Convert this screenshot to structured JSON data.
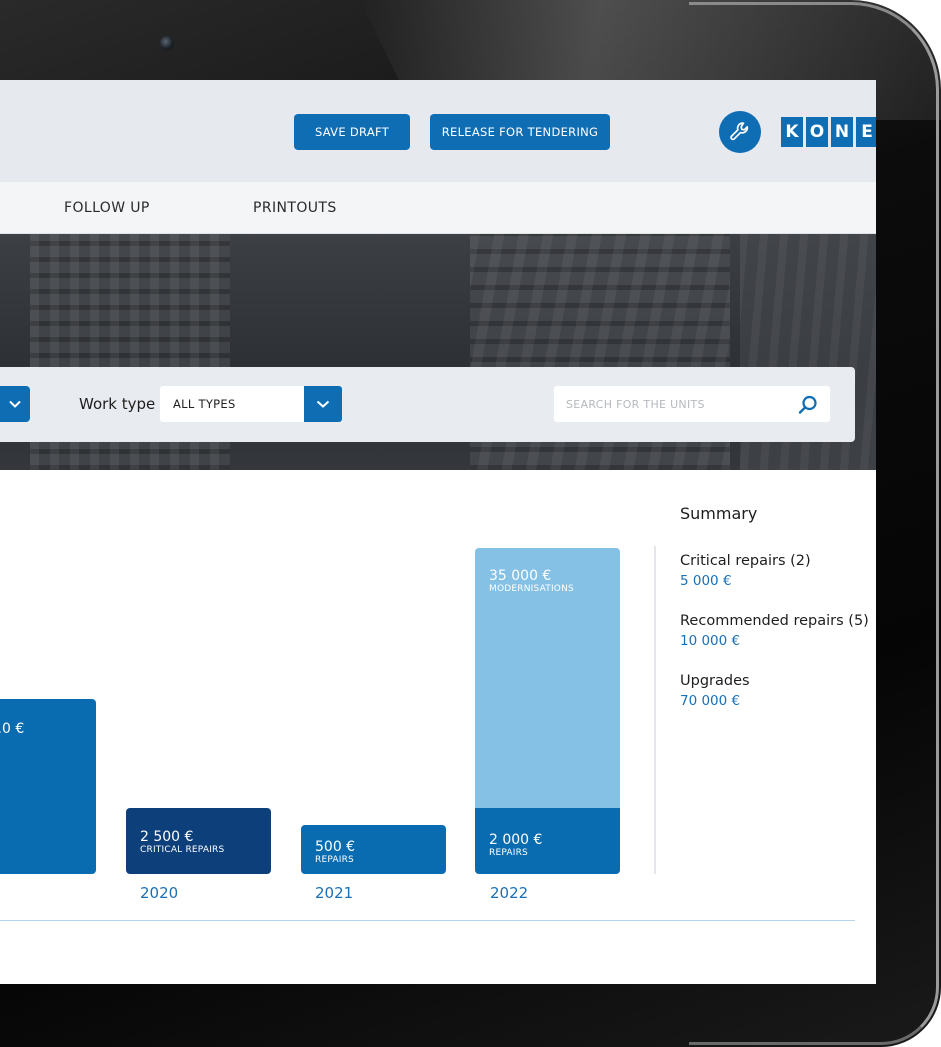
{
  "header": {
    "save_draft_label": "SAVE DRAFT",
    "release_label": "RELEASE FOR TENDERING",
    "logo_letters": [
      "K",
      "O",
      "N",
      "E"
    ]
  },
  "nav": {
    "items": [
      {
        "label": "FOLLOW UP"
      },
      {
        "label": "PRINTOUTS"
      }
    ]
  },
  "filters": {
    "work_type_label": "Work type",
    "work_type_value": "ALL TYPES",
    "search_placeholder": "SEARCH FOR THE UNITS"
  },
  "chart_data": {
    "type": "bar",
    "stacked": true,
    "categories": [
      "",
      "2020",
      "2021",
      "2022"
    ],
    "bars": [
      {
        "year": "",
        "segments": [
          {
            "amount": "…0 €",
            "label": "",
            "value": 17500,
            "color": "#0a6cb0"
          }
        ]
      },
      {
        "year": "2020",
        "segments": [
          {
            "amount": "2 500 €",
            "label": "CRITICAL REPAIRS",
            "value": 2500,
            "color": "#0d3f7a"
          }
        ]
      },
      {
        "year": "2021",
        "segments": [
          {
            "amount": "500 €",
            "label": "REPAIRS",
            "value": 500,
            "color": "#0a6cb0"
          }
        ]
      },
      {
        "year": "2022",
        "segments": [
          {
            "amount": "2 000 €",
            "label": "REPAIRS",
            "value": 2000,
            "color": "#0a6cb0"
          },
          {
            "amount": "35 000 €",
            "label": "MODERNISATIONS",
            "value": 35000,
            "color": "#85c1e5"
          }
        ]
      }
    ]
  },
  "summary": {
    "title": "Summary",
    "items": [
      {
        "label": "Critical repairs (2)",
        "value": "5 000 €"
      },
      {
        "label": "Recommended repairs (5)",
        "value": "10 000 €"
      },
      {
        "label": "Upgrades",
        "value": "70 000 €"
      }
    ]
  },
  "colors": {
    "brand_blue": "#0f6db4",
    "dark_blue": "#0d3f7a",
    "light_blue": "#85c1e5",
    "link_blue": "#1a6fb5"
  },
  "icons": {
    "wrench": "wrench-icon",
    "search": "search-icon",
    "chevron": "chevron-down-icon"
  }
}
